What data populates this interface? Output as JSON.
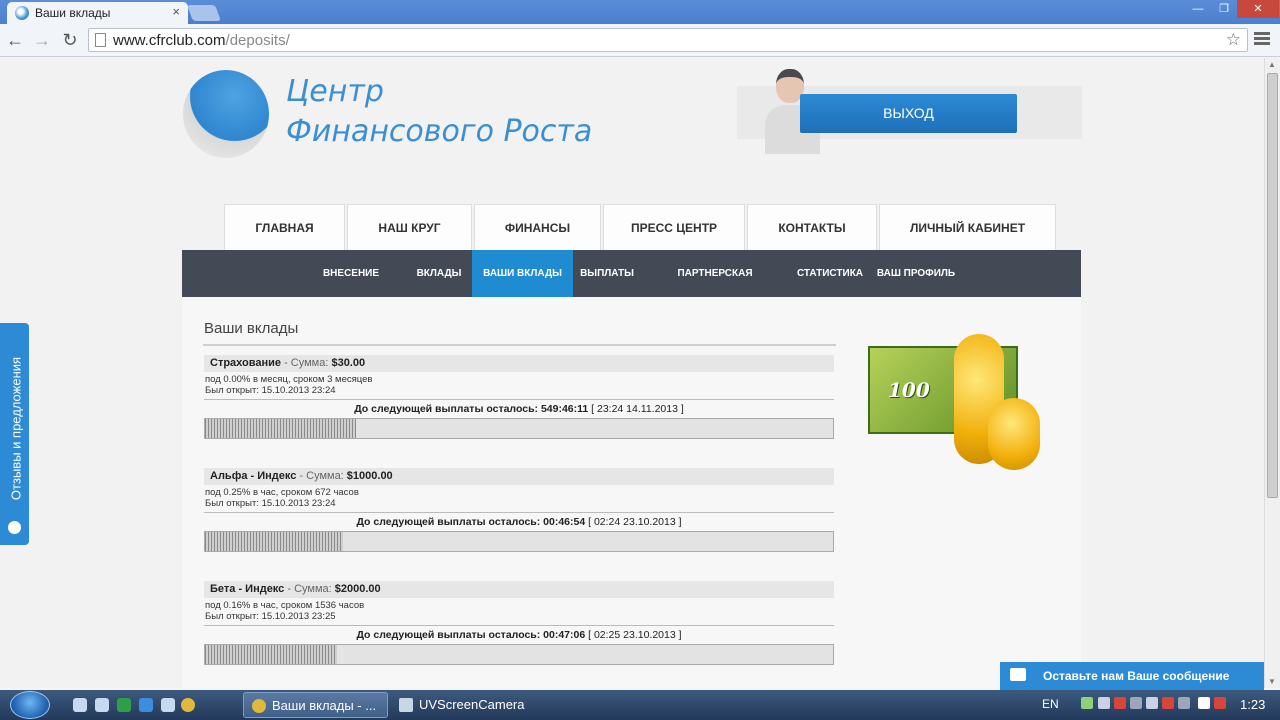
{
  "browser": {
    "tab_title": "Ваши вклады",
    "tab_close": "×",
    "url_host": "www.cfrclub.com",
    "url_path": "/deposits/",
    "window_min": "—",
    "window_max": "❐",
    "window_close": "✕"
  },
  "site": {
    "brand_line1": "Центр",
    "brand_line2": "Финансового Роста",
    "logout_label": "ВЫХОД",
    "main_nav": [
      "ГЛАВНАЯ",
      "НАШ КРУГ",
      "ФИНАНСЫ",
      "ПРЕСС ЦЕНТР",
      "КОНТАКТЫ",
      "ЛИЧНЫЙ КАБИНЕТ"
    ],
    "sub_nav": [
      "ВНЕСЕНИЕ СРЕДСТВ",
      "ВКЛАДЫ",
      "ВАШИ ВКЛАДЫ",
      "ВЫПЛАТЫ",
      "ПАРТНЕРСКАЯ ПРОГРАММА",
      "СТАТИСТИКА",
      "ВАШ ПРОФИЛЬ"
    ],
    "sub_nav_active": "ВАШИ ВКЛАДЫ",
    "section_title": "Ваши вклады",
    "money_label": "100",
    "feedback_tab": "Отзывы и предложения",
    "chat_label": "Оставьте нам Ваше сообщение"
  },
  "deposits": [
    {
      "name": "Страхование",
      "sum_label": " - Сумма: ",
      "amount": "$30.00",
      "terms": "под 0.00% в месяц, сроком 3 месяцев",
      "opened": "Был открыт: 15.10.2013 23:24",
      "next_label": "До следующей выплаты осталось: ",
      "countdown": "549:46:11",
      "next_date": " [ 23:24 14.11.2013 ]",
      "progress": 0.24
    },
    {
      "name": "Альфа - Индекс",
      "sum_label": " - Сумма: ",
      "amount": "$1000.00",
      "terms": "под 0.25% в час, сроком 672 часов",
      "opened": "Был открыт: 15.10.2013 23:24",
      "next_label": "До следующей выплаты осталось: ",
      "countdown": "00:46:54",
      "next_date": " [ 02:24 23.10.2013 ]",
      "progress": 0.22
    },
    {
      "name": "Бета - Индекс",
      "sum_label": " - Сумма: ",
      "amount": "$2000.00",
      "terms": "под 0.16% в час, сроком 1536 часов",
      "opened": "Был открыт: 15.10.2013 23:25",
      "next_label": "До следующей выплаты осталось: ",
      "countdown": "00:47:06",
      "next_date": " [ 02:25 23.10.2013 ]",
      "progress": 0.21
    }
  ],
  "taskbar": {
    "chrome_task": "Ваши вклады - ...",
    "uv_task": "UVScreenCamera",
    "lang": "EN",
    "clock": "1:23"
  },
  "colors": {
    "accent": "#2d8bd5",
    "subnav_bg": "#434a56",
    "subnav_active": "#1f8bd0"
  }
}
